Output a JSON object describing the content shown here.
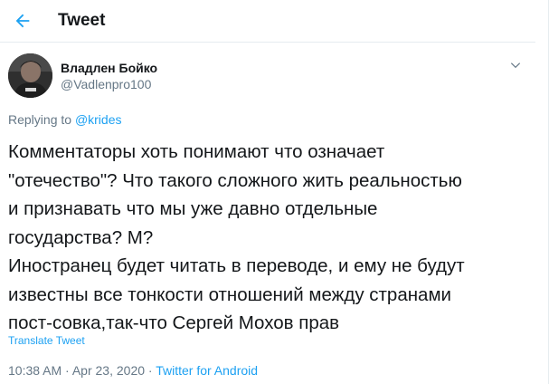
{
  "header": {
    "title": "Tweet",
    "back_icon": "arrow-left-icon",
    "accent_color": "#1da1f2"
  },
  "author": {
    "name": "Владлен Бойко",
    "handle": "@Vadlenpro100",
    "avatar_icon": "user-avatar"
  },
  "reply": {
    "prefix": "Replying to",
    "target": "@krides"
  },
  "tweet": {
    "lines": [
      "Комментаторы хоть понимают что означает",
      "\"отечество\"? Что такого сложного жить реальностью",
      "и признавать что мы уже давно отдельные",
      "государства? М?",
      "Иностранец будет читать в переводе, и ему не будут",
      "известны все тонкости отношений между странами",
      "пост-совка,так-что Сергей Мохов прав"
    ],
    "translate_label": "Translate Tweet"
  },
  "meta": {
    "time": "10:38 AM",
    "date": "Apr 23, 2020",
    "separator": "·",
    "source": "Twitter for Android"
  }
}
